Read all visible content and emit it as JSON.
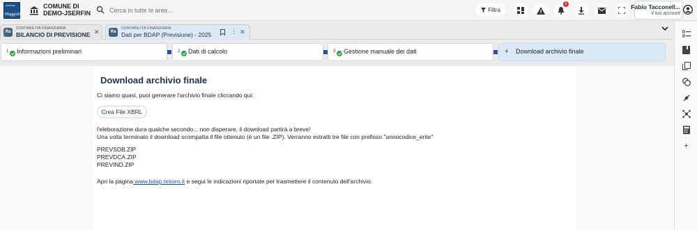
{
  "header": {
    "logo_top_text": "COMUNE",
    "logo_text": "Maggioli",
    "municipality_name": "COMUNE DI DEMO-JSERFIN",
    "search": {
      "placeholder": "Cerca in tutte le aree..."
    },
    "filter_label": "Filtra",
    "notification_count": "5",
    "user": {
      "name": "Fabio Tacconell...",
      "subtitle": "Il tuo account"
    },
    "icons": [
      "dashboard-icon",
      "warning-icon",
      "bell-icon",
      "download-icon",
      "mail-icon",
      "fullscreen-icon",
      "account-icon"
    ]
  },
  "tabs": [
    {
      "logo": "Ra",
      "supertitle": "CONTABILITÀ FINANZIARIA",
      "title": "BILANCIO DI PREVISIONE",
      "active": false
    },
    {
      "logo": "Ra",
      "supertitle": "CONTABILITÀ FINANZIARIA",
      "title": "Dati per BDAP (Previsione) - 2025",
      "active": true
    }
  ],
  "stepper": [
    {
      "number": "1",
      "label": "Informazioni preliminari",
      "completed": true
    },
    {
      "number": "2",
      "label": "Dati di calcolo",
      "completed": true
    },
    {
      "number": "3",
      "label": "Gestione manuale dei dati",
      "completed": true
    },
    {
      "number": "4",
      "label": "Download archivio finale",
      "completed": false,
      "current": true
    }
  ],
  "main": {
    "title": "Download archivio finale",
    "intro": "Ci siamo quasi, puoi generare l'archivio finale cliccando qui:",
    "create_button": "Crea File XBRL",
    "note_line1": "l'eleborazione dura qualche secondo... non disperare, il download partirà a breve!",
    "note_line2": "Una volta terminato il download scompatta il file ottenuto (è un file .ZIP). Verranno estratti tre file con prefisso \"annocodice_ente\"",
    "files": [
      "PREVSDB.ZIP",
      "PREVDCA.ZIP",
      "PREVIND.ZIP"
    ],
    "footer_prefix": "Apri la pagina",
    "footer_link": " www.bdap.tesoro.it",
    "footer_suffix": " e segui le indicazioni riportate per trasmettere il contenuto dell'archivio."
  },
  "right_sidebar_icons": [
    "checklist-icon",
    "book-icon",
    "copy-icon",
    "coins-icon",
    "plug-icon",
    "network-icon",
    "calculator-icon",
    "plus-icon"
  ],
  "colors": {
    "accent": "#1d3350",
    "connector": "#2f4f97",
    "success": "#2e9b45",
    "link": "#1f4fa3",
    "current_step_bg": "#dbe9f7"
  }
}
